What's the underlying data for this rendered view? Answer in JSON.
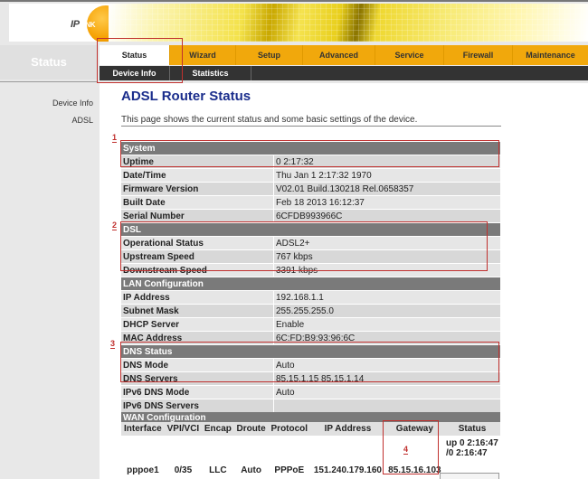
{
  "brand": {
    "logo_ip": "IP",
    "logo_link": "LINK"
  },
  "sidebar": {
    "title": "Status",
    "items": [
      {
        "label": "Device Info"
      },
      {
        "label": "ADSL"
      }
    ]
  },
  "nav": {
    "tabs": [
      {
        "label": "Status",
        "active": true
      },
      {
        "label": "Wizard"
      },
      {
        "label": "Setup"
      },
      {
        "label": "Advanced"
      },
      {
        "label": "Service"
      },
      {
        "label": "Firewall"
      },
      {
        "label": "Maintenance"
      }
    ],
    "subtabs": [
      {
        "label": "Device Info",
        "active": true
      },
      {
        "label": "Statistics"
      }
    ]
  },
  "page": {
    "title": "ADSL Router Status",
    "description": "This page shows the current status and some basic settings of the device."
  },
  "sections": {
    "system": {
      "title": "System",
      "rows": [
        {
          "key": "Uptime",
          "value": "0 2:17:32"
        },
        {
          "key": "Date/Time",
          "value": "Thu Jan 1 2:17:32 1970"
        },
        {
          "key": "Firmware Version",
          "value": "V02.01 Build.130218 Rel.0658357"
        },
        {
          "key": "Built Date",
          "value": "Feb 18 2013 16:12:37"
        },
        {
          "key": "Serial Number",
          "value": "6CFDB993966C"
        }
      ]
    },
    "dsl": {
      "title": "DSL",
      "rows": [
        {
          "key": "Operational Status",
          "value": "ADSL2+"
        },
        {
          "key": "Upstream Speed",
          "value": "767 kbps"
        },
        {
          "key": "Downstream Speed",
          "value": "3391 kbps"
        }
      ]
    },
    "lan": {
      "title": "LAN Configuration",
      "rows": [
        {
          "key": "IP Address",
          "value": "192.168.1.1"
        },
        {
          "key": "Subnet Mask",
          "value": "255.255.255.0"
        },
        {
          "key": "DHCP Server",
          "value": "Enable"
        },
        {
          "key": "MAC Address",
          "value": "6C:FD:B9:93:96:6C"
        }
      ]
    },
    "dns": {
      "title": "DNS Status",
      "rows": [
        {
          "key": "DNS Mode",
          "value": "Auto"
        },
        {
          "key": "DNS Servers",
          "value": "85.15.1.15 85.15.1.14"
        },
        {
          "key": "IPv6 DNS Mode",
          "value": "Auto"
        },
        {
          "key": "IPv6 DNS Servers",
          "value": ""
        }
      ]
    },
    "wan": {
      "title": "WAN Configuration",
      "columns": [
        "Interface",
        "VPI/VCI",
        "Encap",
        "Droute",
        "Protocol",
        "IP Address",
        "Gateway",
        "Status"
      ],
      "rows": [
        {
          "interface": "pppoe1",
          "vpi_vci": "0/35",
          "encap": "LLC",
          "droute": "Auto",
          "protocol": "PPPoE",
          "ip": "151.240.179.160",
          "gateway": "85.15.16.103",
          "status": "up 0 2:16:47 /0 2:16:47"
        }
      ]
    }
  },
  "annotations": [
    "1",
    "2",
    "3",
    "4"
  ],
  "colors": {
    "accent_tab": "#f1a80c",
    "section_header": "#7a7a7a",
    "title_blue": "#1a2d8c",
    "annotation_red": "#c0302e"
  }
}
